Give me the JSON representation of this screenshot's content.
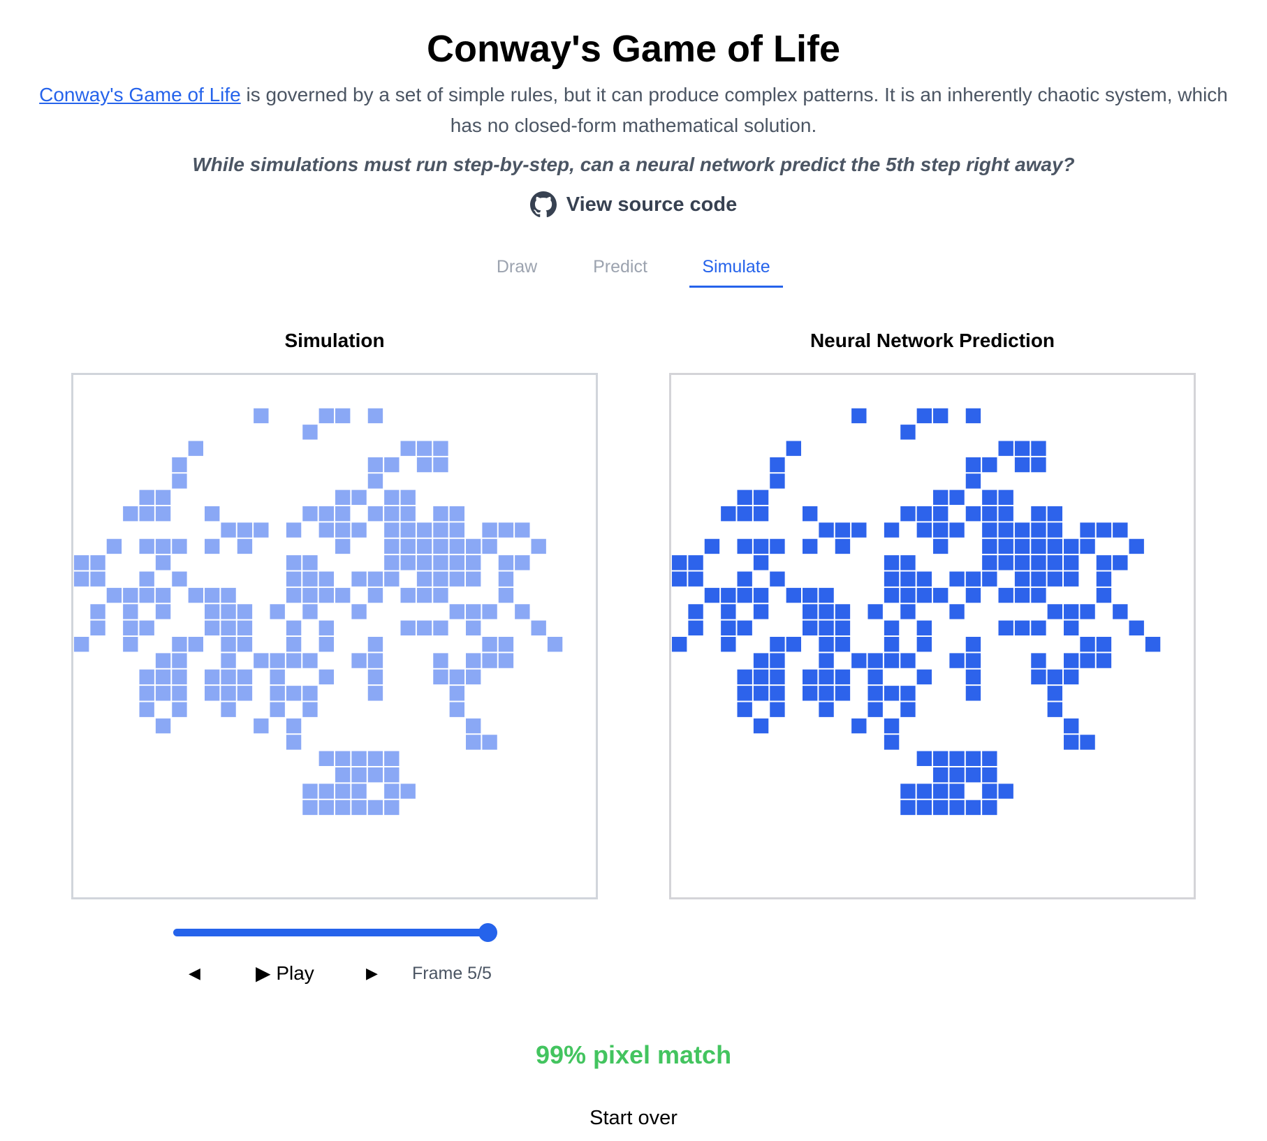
{
  "header": {
    "title": "Conway's Game of Life",
    "intro_link": "Conway's Game of Life",
    "intro_text": " is governed by a set of simple rules, but it can produce complex patterns. It is an inherently chaotic system, which has no closed-form mathematical solution.",
    "question": "While simulations must run step-by-step, can a neural network predict the 5th step right away?",
    "source_label": "View source code",
    "source_icon": "github-icon"
  },
  "tabs": [
    "Draw",
    "Predict",
    "Simulate"
  ],
  "active_tab": "Simulate",
  "panels": {
    "simulation_title": "Simulation",
    "prediction_title": "Neural Network Prediction",
    "simulation_color": "#8aa8f5",
    "prediction_color": "#2d63eb",
    "grid_size": 32,
    "cells": [
      [
        2,
        15
      ],
      [
        2,
        11
      ],
      [
        2,
        16
      ],
      [
        2,
        18
      ],
      [
        3,
        14
      ],
      [
        4,
        7
      ],
      [
        4,
        20
      ],
      [
        4,
        21
      ],
      [
        4,
        22
      ],
      [
        5,
        6
      ],
      [
        5,
        18
      ],
      [
        5,
        19
      ],
      [
        5,
        21
      ],
      [
        5,
        22
      ],
      [
        6,
        6
      ],
      [
        6,
        18
      ],
      [
        7,
        4
      ],
      [
        7,
        5
      ],
      [
        7,
        16
      ],
      [
        7,
        17
      ],
      [
        7,
        19
      ],
      [
        7,
        20
      ],
      [
        8,
        3
      ],
      [
        8,
        4
      ],
      [
        8,
        5
      ],
      [
        8,
        8
      ],
      [
        8,
        14
      ],
      [
        8,
        15
      ],
      [
        8,
        16
      ],
      [
        8,
        18
      ],
      [
        8,
        19
      ],
      [
        8,
        20
      ],
      [
        8,
        22
      ],
      [
        8,
        23
      ],
      [
        9,
        9
      ],
      [
        9,
        10
      ],
      [
        9,
        11
      ],
      [
        9,
        13
      ],
      [
        9,
        15
      ],
      [
        9,
        16
      ],
      [
        9,
        17
      ],
      [
        9,
        19
      ],
      [
        9,
        20
      ],
      [
        9,
        21
      ],
      [
        9,
        22
      ],
      [
        9,
        23
      ],
      [
        9,
        25
      ],
      [
        9,
        26
      ],
      [
        9,
        27
      ],
      [
        10,
        2
      ],
      [
        10,
        4
      ],
      [
        10,
        5
      ],
      [
        10,
        6
      ],
      [
        10,
        8
      ],
      [
        10,
        10
      ],
      [
        10,
        16
      ],
      [
        10,
        19
      ],
      [
        10,
        20
      ],
      [
        10,
        21
      ],
      [
        10,
        22
      ],
      [
        10,
        23
      ],
      [
        10,
        24
      ],
      [
        10,
        25
      ],
      [
        10,
        28
      ],
      [
        11,
        0
      ],
      [
        11,
        1
      ],
      [
        11,
        5
      ],
      [
        11,
        13
      ],
      [
        11,
        14
      ],
      [
        11,
        19
      ],
      [
        11,
        20
      ],
      [
        11,
        21
      ],
      [
        11,
        22
      ],
      [
        11,
        23
      ],
      [
        11,
        24
      ],
      [
        11,
        26
      ],
      [
        11,
        27
      ],
      [
        12,
        0
      ],
      [
        12,
        1
      ],
      [
        12,
        4
      ],
      [
        12,
        6
      ],
      [
        12,
        13
      ],
      [
        12,
        14
      ],
      [
        12,
        15
      ],
      [
        12,
        17
      ],
      [
        12,
        18
      ],
      [
        12,
        19
      ],
      [
        12,
        21
      ],
      [
        12,
        22
      ],
      [
        12,
        23
      ],
      [
        12,
        24
      ],
      [
        12,
        26
      ],
      [
        13,
        2
      ],
      [
        13,
        3
      ],
      [
        13,
        4
      ],
      [
        13,
        5
      ],
      [
        13,
        7
      ],
      [
        13,
        8
      ],
      [
        13,
        9
      ],
      [
        13,
        13
      ],
      [
        13,
        14
      ],
      [
        13,
        15
      ],
      [
        13,
        16
      ],
      [
        13,
        18
      ],
      [
        13,
        20
      ],
      [
        13,
        21
      ],
      [
        13,
        22
      ],
      [
        13,
        26
      ],
      [
        14,
        1
      ],
      [
        14,
        3
      ],
      [
        14,
        5
      ],
      [
        14,
        8
      ],
      [
        14,
        9
      ],
      [
        14,
        10
      ],
      [
        14,
        12
      ],
      [
        14,
        14
      ],
      [
        14,
        17
      ],
      [
        14,
        23
      ],
      [
        14,
        24
      ],
      [
        14,
        25
      ],
      [
        14,
        27
      ],
      [
        15,
        1
      ],
      [
        15,
        3
      ],
      [
        15,
        4
      ],
      [
        15,
        8
      ],
      [
        15,
        9
      ],
      [
        15,
        10
      ],
      [
        15,
        13
      ],
      [
        15,
        15
      ],
      [
        15,
        20
      ],
      [
        15,
        21
      ],
      [
        15,
        22
      ],
      [
        15,
        24
      ],
      [
        15,
        28
      ],
      [
        16,
        0
      ],
      [
        16,
        3
      ],
      [
        16,
        6
      ],
      [
        16,
        7
      ],
      [
        16,
        9
      ],
      [
        16,
        10
      ],
      [
        16,
        13
      ],
      [
        16,
        15
      ],
      [
        16,
        18
      ],
      [
        16,
        25
      ],
      [
        16,
        26
      ],
      [
        16,
        29
      ],
      [
        17,
        5
      ],
      [
        17,
        6
      ],
      [
        17,
        9
      ],
      [
        17,
        11
      ],
      [
        17,
        12
      ],
      [
        17,
        13
      ],
      [
        17,
        14
      ],
      [
        17,
        17
      ],
      [
        17,
        18
      ],
      [
        17,
        22
      ],
      [
        17,
        24
      ],
      [
        17,
        25
      ],
      [
        17,
        26
      ],
      [
        18,
        4
      ],
      [
        18,
        5
      ],
      [
        18,
        6
      ],
      [
        18,
        8
      ],
      [
        18,
        9
      ],
      [
        18,
        10
      ],
      [
        18,
        12
      ],
      [
        18,
        15
      ],
      [
        18,
        18
      ],
      [
        18,
        22
      ],
      [
        18,
        23
      ],
      [
        18,
        24
      ],
      [
        19,
        4
      ],
      [
        19,
        5
      ],
      [
        19,
        6
      ],
      [
        19,
        8
      ],
      [
        19,
        9
      ],
      [
        19,
        10
      ],
      [
        19,
        12
      ],
      [
        19,
        13
      ],
      [
        19,
        14
      ],
      [
        19,
        18
      ],
      [
        19,
        23
      ],
      [
        20,
        4
      ],
      [
        20,
        6
      ],
      [
        20,
        9
      ],
      [
        20,
        12
      ],
      [
        20,
        14
      ],
      [
        20,
        23
      ],
      [
        21,
        5
      ],
      [
        21,
        11
      ],
      [
        21,
        13
      ],
      [
        21,
        24
      ],
      [
        22,
        13
      ],
      [
        22,
        24
      ],
      [
        22,
        25
      ],
      [
        23,
        15
      ],
      [
        23,
        16
      ],
      [
        23,
        17
      ],
      [
        23,
        18
      ],
      [
        23,
        19
      ],
      [
        24,
        16
      ],
      [
        24,
        17
      ],
      [
        24,
        18
      ],
      [
        24,
        19
      ],
      [
        25,
        14
      ],
      [
        25,
        15
      ],
      [
        25,
        16
      ],
      [
        25,
        17
      ],
      [
        25,
        19
      ],
      [
        25,
        20
      ],
      [
        26,
        14
      ],
      [
        26,
        15
      ],
      [
        26,
        16
      ],
      [
        26,
        17
      ],
      [
        26,
        18
      ],
      [
        26,
        19
      ]
    ]
  },
  "playback": {
    "slider_value": 1.0,
    "prev_label": "◀",
    "play_label": "▶ Play",
    "next_label": "▶",
    "frame_label": "Frame 5/5"
  },
  "result": {
    "match_label": "99% pixel match"
  },
  "footer": {
    "start_over_label": "Start over"
  }
}
